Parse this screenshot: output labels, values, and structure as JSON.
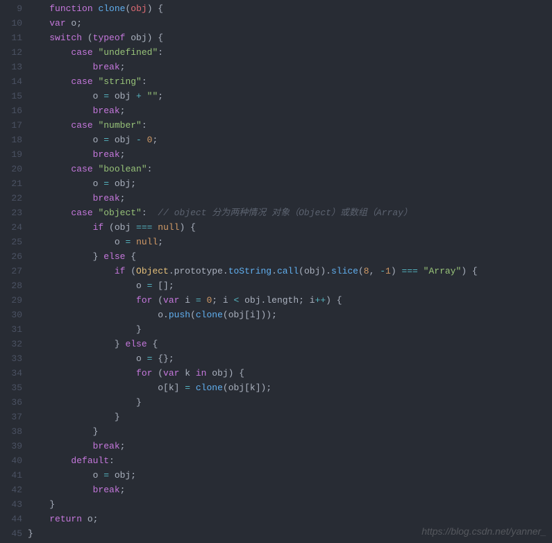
{
  "startLine": 9,
  "endLine": 45,
  "watermark": "https://blog.csdn.net/yanner_",
  "lines": [
    [
      [
        "    ",
        ""
      ],
      [
        "function",
        "tok-keyword"
      ],
      [
        " ",
        ""
      ],
      [
        "clone",
        "tok-func"
      ],
      [
        "(",
        "tok-punc"
      ],
      [
        "obj",
        "tok-param"
      ],
      [
        ") {",
        "tok-punc"
      ]
    ],
    [
      [
        "    ",
        ""
      ],
      [
        "var",
        "tok-var"
      ],
      [
        " o",
        ""
      ],
      [
        ";",
        "tok-punc"
      ]
    ],
    [
      [
        "    ",
        ""
      ],
      [
        "switch",
        "tok-keyword"
      ],
      [
        " (",
        "tok-punc"
      ],
      [
        "typeof",
        "tok-keyword"
      ],
      [
        " obj",
        "tok-ident"
      ],
      [
        ") {",
        "tok-punc"
      ]
    ],
    [
      [
        "        ",
        ""
      ],
      [
        "case",
        "tok-keyword"
      ],
      [
        " ",
        ""
      ],
      [
        "\"undefined\"",
        "tok-string"
      ],
      [
        ":",
        "tok-punc"
      ]
    ],
    [
      [
        "            ",
        ""
      ],
      [
        "break",
        "tok-keyword"
      ],
      [
        ";",
        "tok-punc"
      ]
    ],
    [
      [
        "        ",
        ""
      ],
      [
        "case",
        "tok-keyword"
      ],
      [
        " ",
        ""
      ],
      [
        "\"string\"",
        "tok-string"
      ],
      [
        ":",
        "tok-punc"
      ]
    ],
    [
      [
        "            o ",
        ""
      ],
      [
        "=",
        "tok-op"
      ],
      [
        " obj ",
        ""
      ],
      [
        "+",
        "tok-op"
      ],
      [
        " ",
        ""
      ],
      [
        "\"\"",
        "tok-string"
      ],
      [
        ";",
        "tok-punc"
      ]
    ],
    [
      [
        "            ",
        ""
      ],
      [
        "break",
        "tok-keyword"
      ],
      [
        ";",
        "tok-punc"
      ]
    ],
    [
      [
        "        ",
        ""
      ],
      [
        "case",
        "tok-keyword"
      ],
      [
        " ",
        ""
      ],
      [
        "\"number\"",
        "tok-string"
      ],
      [
        ":",
        "tok-punc"
      ]
    ],
    [
      [
        "            o ",
        ""
      ],
      [
        "=",
        "tok-op"
      ],
      [
        " obj ",
        ""
      ],
      [
        "-",
        "tok-op"
      ],
      [
        " ",
        ""
      ],
      [
        "0",
        "tok-number"
      ],
      [
        ";",
        "tok-punc"
      ]
    ],
    [
      [
        "            ",
        ""
      ],
      [
        "break",
        "tok-keyword"
      ],
      [
        ";",
        "tok-punc"
      ]
    ],
    [
      [
        "        ",
        ""
      ],
      [
        "case",
        "tok-keyword"
      ],
      [
        " ",
        ""
      ],
      [
        "\"boolean\"",
        "tok-string"
      ],
      [
        ":",
        "tok-punc"
      ]
    ],
    [
      [
        "            o ",
        ""
      ],
      [
        "=",
        "tok-op"
      ],
      [
        " obj",
        ""
      ],
      [
        ";",
        "tok-punc"
      ]
    ],
    [
      [
        "            ",
        ""
      ],
      [
        "break",
        "tok-keyword"
      ],
      [
        ";",
        "tok-punc"
      ]
    ],
    [
      [
        "        ",
        ""
      ],
      [
        "case",
        "tok-keyword"
      ],
      [
        " ",
        ""
      ],
      [
        "\"object\"",
        "tok-string"
      ],
      [
        ":",
        "tok-punc"
      ],
      [
        "  ",
        ""
      ],
      [
        "// object 分为两种情况 对象（Object）或数组（Array）",
        "tok-comment"
      ]
    ],
    [
      [
        "            ",
        ""
      ],
      [
        "if",
        "tok-keyword"
      ],
      [
        " (obj ",
        ""
      ],
      [
        "===",
        "tok-op"
      ],
      [
        " ",
        ""
      ],
      [
        "null",
        "tok-const"
      ],
      [
        ") {",
        "tok-punc"
      ]
    ],
    [
      [
        "                o ",
        ""
      ],
      [
        "=",
        "tok-op"
      ],
      [
        " ",
        ""
      ],
      [
        "null",
        "tok-const"
      ],
      [
        ";",
        "tok-punc"
      ]
    ],
    [
      [
        "            } ",
        ""
      ],
      [
        "else",
        "tok-keyword"
      ],
      [
        " {",
        "tok-punc"
      ]
    ],
    [
      [
        "                ",
        ""
      ],
      [
        "if",
        "tok-keyword"
      ],
      [
        " (",
        "tok-punc"
      ],
      [
        "Object",
        "tok-global"
      ],
      [
        ".",
        ""
      ],
      [
        "prototype",
        "tok-ident"
      ],
      [
        ".",
        ""
      ],
      [
        "toString",
        "tok-prop"
      ],
      [
        ".",
        ""
      ],
      [
        "call",
        "tok-prop"
      ],
      [
        "(obj).",
        ""
      ],
      [
        "slice",
        "tok-prop"
      ],
      [
        "(",
        "tok-punc"
      ],
      [
        "8",
        "tok-number"
      ],
      [
        ", ",
        ""
      ],
      [
        "-",
        "tok-op"
      ],
      [
        "1",
        "tok-number"
      ],
      [
        ") ",
        ""
      ],
      [
        "===",
        "tok-op"
      ],
      [
        " ",
        ""
      ],
      [
        "\"Array\"",
        "tok-string"
      ],
      [
        ") {",
        "tok-punc"
      ]
    ],
    [
      [
        "                    o ",
        ""
      ],
      [
        "=",
        "tok-op"
      ],
      [
        " []",
        ""
      ],
      [
        ";",
        "tok-punc"
      ]
    ],
    [
      [
        "                    ",
        ""
      ],
      [
        "for",
        "tok-keyword"
      ],
      [
        " (",
        "tok-punc"
      ],
      [
        "var",
        "tok-var"
      ],
      [
        " i ",
        ""
      ],
      [
        "=",
        "tok-op"
      ],
      [
        " ",
        ""
      ],
      [
        "0",
        "tok-number"
      ],
      [
        "; i ",
        ""
      ],
      [
        "<",
        "tok-op"
      ],
      [
        " obj.",
        ""
      ],
      [
        "length",
        "tok-ident"
      ],
      [
        "; i",
        ""
      ],
      [
        "++",
        "tok-op"
      ],
      [
        ") {",
        "tok-punc"
      ]
    ],
    [
      [
        "                        o.",
        ""
      ],
      [
        "push",
        "tok-prop"
      ],
      [
        "(",
        "tok-punc"
      ],
      [
        "clone",
        "tok-func"
      ],
      [
        "(obj[i]))",
        ""
      ],
      [
        ";",
        "tok-punc"
      ]
    ],
    [
      [
        "                    }",
        "tok-punc"
      ]
    ],
    [
      [
        "                } ",
        ""
      ],
      [
        "else",
        "tok-keyword"
      ],
      [
        " {",
        "tok-punc"
      ]
    ],
    [
      [
        "                    o ",
        ""
      ],
      [
        "=",
        "tok-op"
      ],
      [
        " {}",
        ""
      ],
      [
        ";",
        "tok-punc"
      ]
    ],
    [
      [
        "                    ",
        ""
      ],
      [
        "for",
        "tok-keyword"
      ],
      [
        " (",
        "tok-punc"
      ],
      [
        "var",
        "tok-var"
      ],
      [
        " k ",
        ""
      ],
      [
        "in",
        "tok-keyword"
      ],
      [
        " obj) {",
        "tok-punc"
      ]
    ],
    [
      [
        "                        o[k] ",
        ""
      ],
      [
        "=",
        "tok-op"
      ],
      [
        " ",
        ""
      ],
      [
        "clone",
        "tok-func"
      ],
      [
        "(obj[k])",
        ""
      ],
      [
        ";",
        "tok-punc"
      ]
    ],
    [
      [
        "                    }",
        "tok-punc"
      ]
    ],
    [
      [
        "                }",
        "tok-punc"
      ]
    ],
    [
      [
        "            }",
        "tok-punc"
      ]
    ],
    [
      [
        "            ",
        ""
      ],
      [
        "break",
        "tok-keyword"
      ],
      [
        ";",
        "tok-punc"
      ]
    ],
    [
      [
        "        ",
        ""
      ],
      [
        "default",
        "tok-keyword"
      ],
      [
        ":",
        "tok-punc"
      ]
    ],
    [
      [
        "            o ",
        ""
      ],
      [
        "=",
        "tok-op"
      ],
      [
        " obj",
        ""
      ],
      [
        ";",
        "tok-punc"
      ]
    ],
    [
      [
        "            ",
        ""
      ],
      [
        "break",
        "tok-keyword"
      ],
      [
        ";",
        "tok-punc"
      ]
    ],
    [
      [
        "    }",
        "tok-punc"
      ]
    ],
    [
      [
        "    ",
        ""
      ],
      [
        "return",
        "tok-keyword"
      ],
      [
        " o",
        ""
      ],
      [
        ";",
        "tok-punc"
      ]
    ],
    [
      [
        "}",
        "tok-punc"
      ]
    ]
  ]
}
